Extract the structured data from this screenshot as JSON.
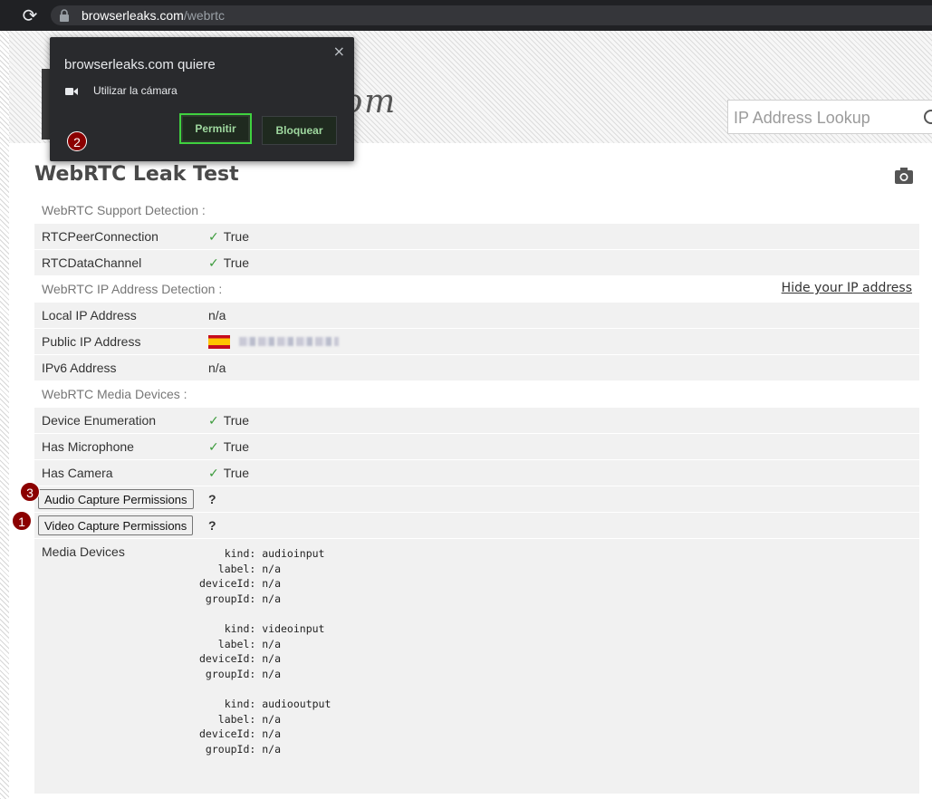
{
  "browser": {
    "url_domain": "browserleaks.com",
    "url_path": "/webrtc"
  },
  "search": {
    "placeholder": "IP Address Lookup"
  },
  "page": {
    "title": "WebRTC Leak Test"
  },
  "popup": {
    "title": "browserleaks.com quiere",
    "permission": "Utilizar la cámara",
    "allow_label": "Permitir",
    "block_label": "Bloquear",
    "close_label": "×"
  },
  "badges": {
    "popup": "2",
    "audio": "3",
    "video": "1"
  },
  "sections": {
    "support": "WebRTC Support Detection :",
    "ip": "WebRTC IP Address Detection :",
    "media": "WebRTC Media Devices :",
    "hide_link": "Hide your IP address"
  },
  "rows": {
    "rtc_peer": {
      "key": "RTCPeerConnection",
      "value": "True"
    },
    "rtc_data": {
      "key": "RTCDataChannel",
      "value": "True"
    },
    "local_ip": {
      "key": "Local IP Address",
      "value": "n/a"
    },
    "public_ip": {
      "key": "Public IP Address"
    },
    "ipv6": {
      "key": "IPv6 Address",
      "value": "n/a"
    },
    "enum": {
      "key": "Device Enumeration",
      "value": "True"
    },
    "mic": {
      "key": "Has Microphone",
      "value": "True"
    },
    "cam": {
      "key": "Has Camera",
      "value": "True"
    },
    "audio_perm": {
      "button": "Audio Capture Permissions",
      "value": "?"
    },
    "video_perm": {
      "button": "Video Capture Permissions",
      "value": "?"
    },
    "media_devices": {
      "key": "Media Devices"
    }
  },
  "check_mark": "✓",
  "media_devices": [
    {
      "kind": "    kind: audioinput",
      "label": "   label: n/a",
      "deviceId": "deviceId: n/a",
      "groupId": " groupId: n/a"
    },
    {
      "kind": "    kind: videoinput",
      "label": "   label: n/a",
      "deviceId": "deviceId: n/a",
      "groupId": " groupId: n/a"
    },
    {
      "kind": "    kind: audiooutput",
      "label": "   label: n/a",
      "deviceId": "deviceId: n/a",
      "groupId": " groupId: n/a"
    }
  ],
  "colors": {
    "badge": "#8b0000",
    "check": "#3b9a3b",
    "allow_border": "#3fd13f"
  }
}
